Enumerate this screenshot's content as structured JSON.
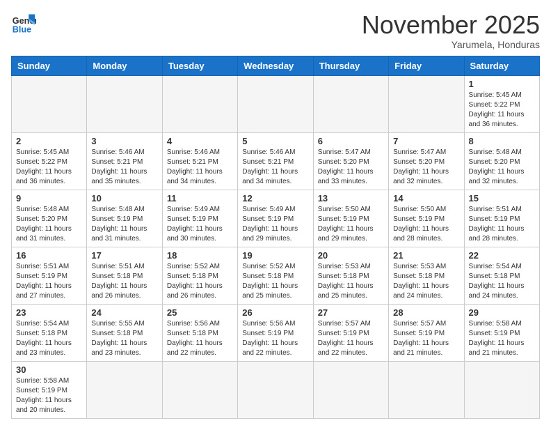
{
  "logo": {
    "line1": "General",
    "line2": "Blue"
  },
  "title": "November 2025",
  "location": "Yarumela, Honduras",
  "days_of_week": [
    "Sunday",
    "Monday",
    "Tuesday",
    "Wednesday",
    "Thursday",
    "Friday",
    "Saturday"
  ],
  "weeks": [
    [
      {
        "day": "",
        "info": ""
      },
      {
        "day": "",
        "info": ""
      },
      {
        "day": "",
        "info": ""
      },
      {
        "day": "",
        "info": ""
      },
      {
        "day": "",
        "info": ""
      },
      {
        "day": "",
        "info": ""
      },
      {
        "day": "1",
        "info": "Sunrise: 5:45 AM\nSunset: 5:22 PM\nDaylight: 11 hours\nand 36 minutes."
      }
    ],
    [
      {
        "day": "2",
        "info": "Sunrise: 5:45 AM\nSunset: 5:22 PM\nDaylight: 11 hours\nand 36 minutes."
      },
      {
        "day": "3",
        "info": "Sunrise: 5:46 AM\nSunset: 5:21 PM\nDaylight: 11 hours\nand 35 minutes."
      },
      {
        "day": "4",
        "info": "Sunrise: 5:46 AM\nSunset: 5:21 PM\nDaylight: 11 hours\nand 34 minutes."
      },
      {
        "day": "5",
        "info": "Sunrise: 5:46 AM\nSunset: 5:21 PM\nDaylight: 11 hours\nand 34 minutes."
      },
      {
        "day": "6",
        "info": "Sunrise: 5:47 AM\nSunset: 5:20 PM\nDaylight: 11 hours\nand 33 minutes."
      },
      {
        "day": "7",
        "info": "Sunrise: 5:47 AM\nSunset: 5:20 PM\nDaylight: 11 hours\nand 32 minutes."
      },
      {
        "day": "8",
        "info": "Sunrise: 5:48 AM\nSunset: 5:20 PM\nDaylight: 11 hours\nand 32 minutes."
      }
    ],
    [
      {
        "day": "9",
        "info": "Sunrise: 5:48 AM\nSunset: 5:20 PM\nDaylight: 11 hours\nand 31 minutes."
      },
      {
        "day": "10",
        "info": "Sunrise: 5:48 AM\nSunset: 5:19 PM\nDaylight: 11 hours\nand 31 minutes."
      },
      {
        "day": "11",
        "info": "Sunrise: 5:49 AM\nSunset: 5:19 PM\nDaylight: 11 hours\nand 30 minutes."
      },
      {
        "day": "12",
        "info": "Sunrise: 5:49 AM\nSunset: 5:19 PM\nDaylight: 11 hours\nand 29 minutes."
      },
      {
        "day": "13",
        "info": "Sunrise: 5:50 AM\nSunset: 5:19 PM\nDaylight: 11 hours\nand 29 minutes."
      },
      {
        "day": "14",
        "info": "Sunrise: 5:50 AM\nSunset: 5:19 PM\nDaylight: 11 hours\nand 28 minutes."
      },
      {
        "day": "15",
        "info": "Sunrise: 5:51 AM\nSunset: 5:19 PM\nDaylight: 11 hours\nand 28 minutes."
      }
    ],
    [
      {
        "day": "16",
        "info": "Sunrise: 5:51 AM\nSunset: 5:19 PM\nDaylight: 11 hours\nand 27 minutes."
      },
      {
        "day": "17",
        "info": "Sunrise: 5:51 AM\nSunset: 5:18 PM\nDaylight: 11 hours\nand 26 minutes."
      },
      {
        "day": "18",
        "info": "Sunrise: 5:52 AM\nSunset: 5:18 PM\nDaylight: 11 hours\nand 26 minutes."
      },
      {
        "day": "19",
        "info": "Sunrise: 5:52 AM\nSunset: 5:18 PM\nDaylight: 11 hours\nand 25 minutes."
      },
      {
        "day": "20",
        "info": "Sunrise: 5:53 AM\nSunset: 5:18 PM\nDaylight: 11 hours\nand 25 minutes."
      },
      {
        "day": "21",
        "info": "Sunrise: 5:53 AM\nSunset: 5:18 PM\nDaylight: 11 hours\nand 24 minutes."
      },
      {
        "day": "22",
        "info": "Sunrise: 5:54 AM\nSunset: 5:18 PM\nDaylight: 11 hours\nand 24 minutes."
      }
    ],
    [
      {
        "day": "23",
        "info": "Sunrise: 5:54 AM\nSunset: 5:18 PM\nDaylight: 11 hours\nand 23 minutes."
      },
      {
        "day": "24",
        "info": "Sunrise: 5:55 AM\nSunset: 5:18 PM\nDaylight: 11 hours\nand 23 minutes."
      },
      {
        "day": "25",
        "info": "Sunrise: 5:56 AM\nSunset: 5:18 PM\nDaylight: 11 hours\nand 22 minutes."
      },
      {
        "day": "26",
        "info": "Sunrise: 5:56 AM\nSunset: 5:19 PM\nDaylight: 11 hours\nand 22 minutes."
      },
      {
        "day": "27",
        "info": "Sunrise: 5:57 AM\nSunset: 5:19 PM\nDaylight: 11 hours\nand 22 minutes."
      },
      {
        "day": "28",
        "info": "Sunrise: 5:57 AM\nSunset: 5:19 PM\nDaylight: 11 hours\nand 21 minutes."
      },
      {
        "day": "29",
        "info": "Sunrise: 5:58 AM\nSunset: 5:19 PM\nDaylight: 11 hours\nand 21 minutes."
      }
    ],
    [
      {
        "day": "30",
        "info": "Sunrise: 5:58 AM\nSunset: 5:19 PM\nDaylight: 11 hours\nand 20 minutes."
      },
      {
        "day": "",
        "info": ""
      },
      {
        "day": "",
        "info": ""
      },
      {
        "day": "",
        "info": ""
      },
      {
        "day": "",
        "info": ""
      },
      {
        "day": "",
        "info": ""
      },
      {
        "day": "",
        "info": ""
      }
    ]
  ]
}
